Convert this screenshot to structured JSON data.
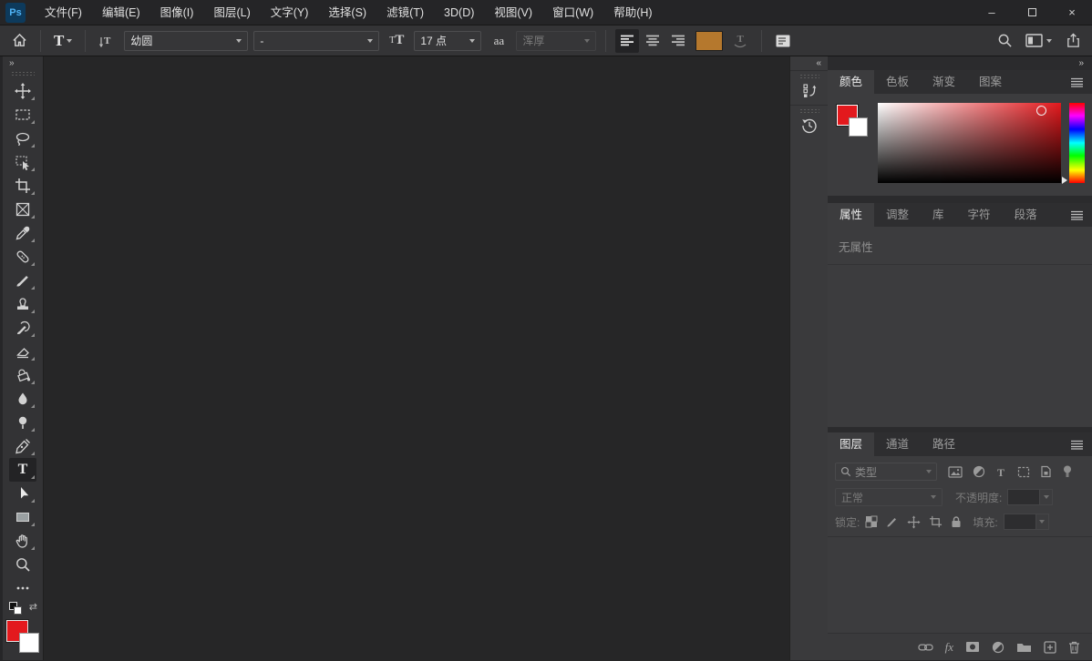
{
  "window": {
    "logo": "Ps",
    "menu": [
      "文件(F)",
      "编辑(E)",
      "图像(I)",
      "图层(L)",
      "文字(Y)",
      "选择(S)",
      "滤镜(T)",
      "3D(D)",
      "视图(V)",
      "窗口(W)",
      "帮助(H)"
    ],
    "controls": {
      "minimize": "–",
      "close": "×"
    }
  },
  "options": {
    "font_family": "幼圆",
    "font_style": "-",
    "font_size": "17 点",
    "anti_alias": "浑厚",
    "text_color": "#b5782d",
    "glyphs": {
      "type_tool": "T",
      "t_small": "T",
      "t_big": "T",
      "aa": "aa",
      "warp": "T"
    }
  },
  "toolbar": {
    "type_glyph": "T",
    "swap": "⇄",
    "foreground": "#e3191d",
    "background": "#ffffff"
  },
  "colors": {
    "canvas": "#262627",
    "picker_hue": "#e3191d"
  },
  "panels": {
    "color": {
      "tabs": [
        "颜色",
        "色板",
        "渐变",
        "图案"
      ]
    },
    "properties": {
      "tabs": [
        "属性",
        "调整",
        "库",
        "字符",
        "段落"
      ],
      "empty_text": "无属性"
    },
    "layers": {
      "tabs": [
        "图层",
        "通道",
        "路径"
      ],
      "filter_placeholder": "类型",
      "blend_mode": "正常",
      "opacity_label": "不透明度:",
      "lock_label": "锁定:",
      "fill_label": "填充:",
      "fx_glyph": "fx"
    }
  },
  "icons": {
    "collapse_left": "»",
    "collapse_right": "«",
    "panels_collapse": "»"
  }
}
